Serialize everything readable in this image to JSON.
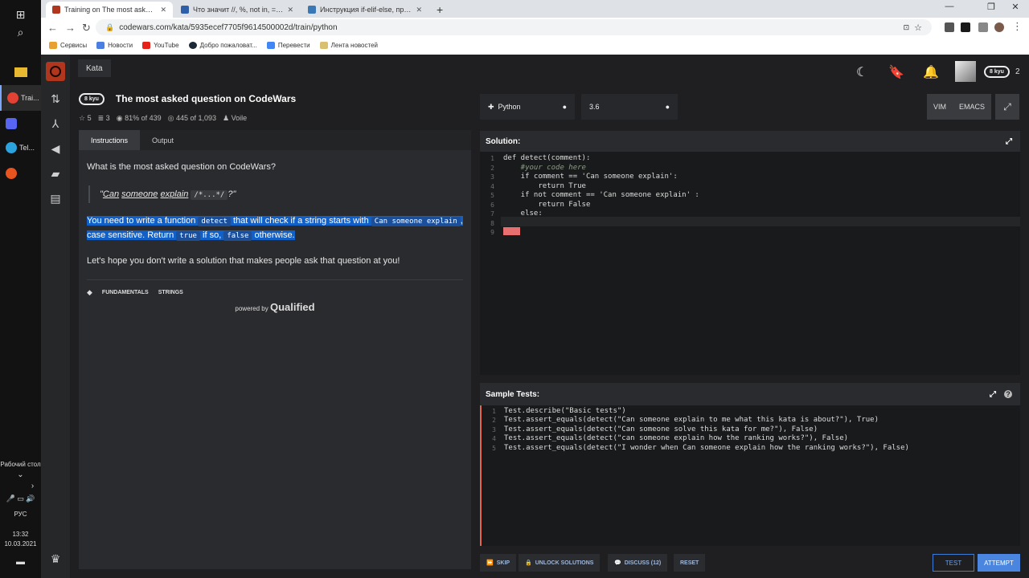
{
  "taskbar": {
    "apps": [
      {
        "label": "Trai...",
        "color": "#e34133"
      },
      {
        "label": "",
        "color": "#5865f2"
      },
      {
        "label": "Tel...",
        "color": "#2aa3df"
      },
      {
        "label": "",
        "color": "#e8531e"
      }
    ],
    "desktop_label": "Рабочий стол",
    "lang": "РУС",
    "time": "13:32",
    "date": "10.03.2021"
  },
  "browser": {
    "tabs": [
      {
        "title": "Training on The most asked question",
        "active": true,
        "color": "#b1361e"
      },
      {
        "title": "Что значит //, %, not in, == и др",
        "active": false,
        "color": "#2f5fa8"
      },
      {
        "title": "Инструкция if-elif-else, провер",
        "active": false,
        "color": "#3a77b7"
      }
    ],
    "url": "codewars.com/kata/5935ecef7705f9614500002d/train/python",
    "bookmarks": [
      "Сервисы",
      "Новости",
      "YouTube",
      "Добро пожаловат...",
      "Перевести",
      "Лента новостей"
    ]
  },
  "app": {
    "top_tab": "Kata",
    "user_rank": "8 kyu",
    "user_honor": "2"
  },
  "kata": {
    "rank": "8 kyu",
    "title": "The most asked question on CodeWars",
    "stars": "5",
    "collections": "3",
    "satisfaction": "81% of 439",
    "completed": "445 of 1,093",
    "author": "Voile"
  },
  "panel": {
    "tab_instructions": "Instructions",
    "tab_output": "Output",
    "q_heading": "What is the most asked question on CodeWars?",
    "quote_1": "\"",
    "quote_can": "Can",
    "quote_someone": "someone",
    "quote_explain": "explain",
    "quote_code": "/*...*/",
    "quote_end": "?\"",
    "p2_a": "You need to write a function",
    "p2_code1": "detect",
    "p2_b": "that will check if a string starts with",
    "p2_code2": "Can someone explain",
    "p2_c": ", case sensitive. Return",
    "p2_code3": "true",
    "p2_d": "if so,",
    "p2_code4": "false",
    "p2_e": "otherwise.",
    "p3": "Let's hope you don't write a solution that makes people ask that question at you!",
    "tags": [
      "FUNDAMENTALS",
      "STRINGS"
    ],
    "powered_by": "powered by",
    "qualified": "Qualified"
  },
  "editor_bar": {
    "language": "Python",
    "version": "3.6",
    "mode_vim": "VIM",
    "mode_emacs": "EMACS"
  },
  "solution": {
    "label": "Solution:",
    "lines": [
      "def detect(comment):",
      "    #your code here",
      "    if comment == 'Can someone explain':",
      "        return True",
      "    if not comment == 'Can someone explain' :",
      "        return False",
      "    else:",
      "",
      ""
    ]
  },
  "tests": {
    "label": "Sample Tests:",
    "lines": [
      "Test.describe(\"Basic tests\")",
      "Test.assert_equals(detect(\"Can someone explain to me what this kata is about?\"), True)",
      "Test.assert_equals(detect(\"Can someone solve this kata for me?\"), False)",
      "Test.assert_equals(detect(\"can someone explain how the ranking works?\"), False)",
      "Test.assert_equals(detect(\"I wonder when Can someone explain how the ranking works?\"), False)"
    ]
  },
  "actions": {
    "skip": "SKIP",
    "unlock": "UNLOCK SOLUTIONS",
    "discuss": "DISCUSS (12)",
    "reset": "RESET",
    "test": "TEST",
    "attempt": "ATTEMPT"
  }
}
